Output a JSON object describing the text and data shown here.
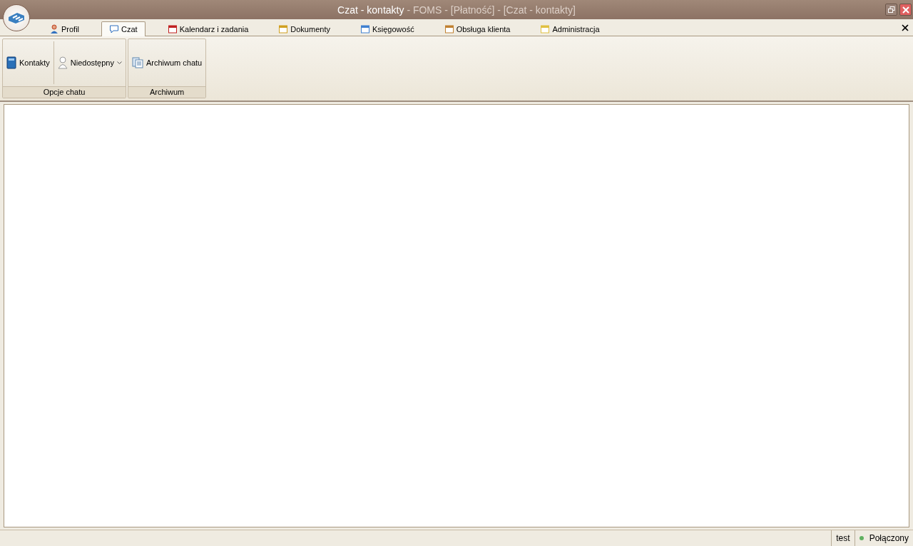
{
  "window": {
    "title_main": "Czat - kontakty",
    "title_rest": "- FOMS - [Płatność] - [Czat - kontakty]"
  },
  "tabs": [
    {
      "label": "Profil",
      "selected": false
    },
    {
      "label": "Czat",
      "selected": true
    },
    {
      "label": "Kalendarz i zadania",
      "selected": false
    },
    {
      "label": "Dokumenty",
      "selected": false
    },
    {
      "label": "Księgowość",
      "selected": false
    },
    {
      "label": "Obsługa klienta",
      "selected": false
    },
    {
      "label": "Administracja",
      "selected": false
    }
  ],
  "ribbon_groups": [
    {
      "label": "Opcje chatu",
      "buttons": [
        {
          "label": "Kontakty",
          "dropdown": false
        },
        {
          "label": "Niedostępny",
          "dropdown": true
        }
      ]
    },
    {
      "label": "Archiwum",
      "buttons": [
        {
          "label": "Archiwum chatu",
          "dropdown": false
        }
      ]
    }
  ],
  "status_bar": {
    "user": "test",
    "connection": "Połączony",
    "connected": true
  }
}
